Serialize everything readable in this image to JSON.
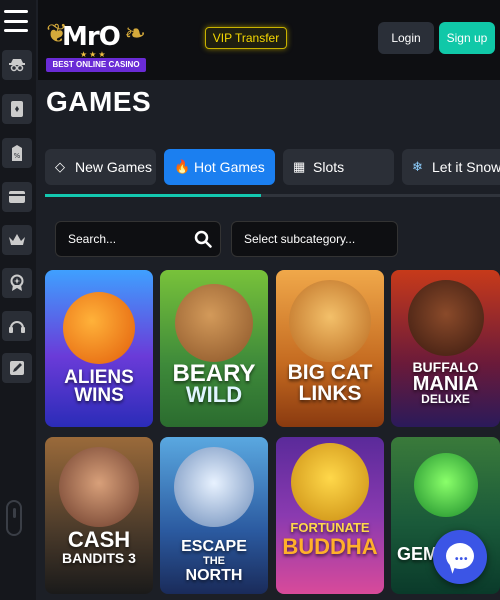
{
  "header": {
    "logo_text": "MrO",
    "logo_tagline": "BEST ONLINE CASINO",
    "vip_label": "VIP Transfer",
    "login_label": "Login",
    "signup_label": "Sign up"
  },
  "sidebar": {
    "items": [
      {
        "icon": "hat-glasses-icon"
      },
      {
        "icon": "playing-card-icon"
      },
      {
        "icon": "tag-icon"
      },
      {
        "icon": "credit-card-icon"
      },
      {
        "icon": "crown-icon"
      },
      {
        "icon": "award-badge-icon"
      },
      {
        "icon": "headset-icon"
      },
      {
        "icon": "edit-note-icon"
      }
    ]
  },
  "page": {
    "title": "GAMES"
  },
  "tabs": [
    {
      "label": "New Games",
      "icon": "diamond-icon",
      "active": false
    },
    {
      "label": "Hot Games",
      "icon": "flame-icon",
      "active": true
    },
    {
      "label": "Slots",
      "icon": "slot-machine-icon",
      "active": false
    },
    {
      "label": "Let it Snow",
      "icon": "snowflake-icon",
      "active": false
    }
  ],
  "filters": {
    "search_placeholder": "Search...",
    "subcategory_label": "Select subcategory..."
  },
  "games": [
    {
      "line1": "ALIENS",
      "line2": "WINS"
    },
    {
      "line1": "BEARY",
      "line2": "WILD"
    },
    {
      "line1": "BIG CAT",
      "line2": "LINKS"
    },
    {
      "line1": "BUFFALO",
      "line2": "MANIA",
      "line3": "DELUXE"
    },
    {
      "line1": "CASH",
      "line2": "BANDITS 3"
    },
    {
      "line1": "ESCAPE",
      "line2": "THE",
      "line3": "NORTH"
    },
    {
      "line1": "FORTUNATE",
      "line2": "BUDDHA"
    },
    {
      "line1": "GEMMA",
      "line2": ""
    }
  ],
  "colors": {
    "accent_blue": "#1b7ff0",
    "accent_teal": "#13c8b0",
    "vip_yellow": "#f5d800"
  }
}
